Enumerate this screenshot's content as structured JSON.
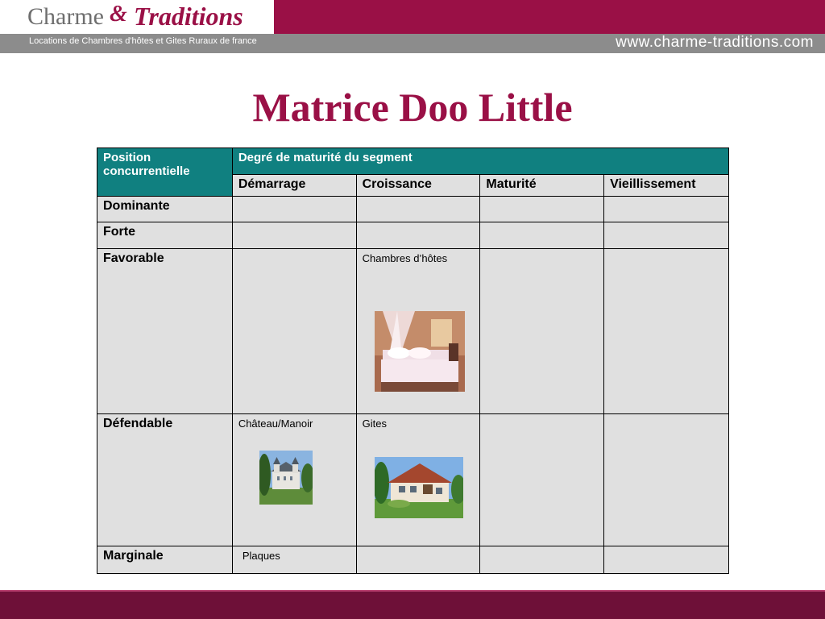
{
  "header": {
    "brand_word1": "Charme",
    "brand_amp": "&",
    "brand_word2": "Traditions",
    "tagline": "Locations de Chambres d'hôtes et Gites Ruraux de france",
    "website": "www.charme-traditions.com",
    "brand_color": "#9a1046"
  },
  "title": "Matrice Doo Little",
  "matrix": {
    "corner_label": "Position concurrentielle",
    "group_header": "Degré de maturité du segment",
    "columns": [
      "Démarrage",
      "Croissance",
      "Maturité",
      "Vieillissement"
    ],
    "rows": [
      {
        "label": "Dominante",
        "cells": [
          "",
          "",
          "",
          ""
        ]
      },
      {
        "label": "Forte",
        "cells": [
          "",
          "",
          "",
          ""
        ]
      },
      {
        "label": "Favorable",
        "cells": [
          "",
          "Chambres d’hôtes",
          "",
          ""
        ]
      },
      {
        "label": "Défendable",
        "cells": [
          "Château/Manoir",
          "Gites",
          "",
          ""
        ]
      },
      {
        "label": "Marginale",
        "cells": [
          "Plaques",
          "",
          "",
          ""
        ]
      }
    ]
  },
  "images": {
    "bedroom": "photo of bedroom with canopy bed",
    "chateau": "photo of château with trees",
    "gites": "photo of country house gîte"
  }
}
